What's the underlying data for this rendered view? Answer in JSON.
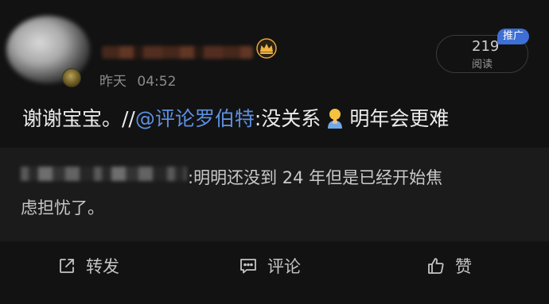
{
  "header": {
    "date_label": "昨天",
    "time": "04:52",
    "read_count": "219",
    "read_label": "阅读",
    "promo_tag": "推广",
    "avatar_icon": "blurred-avatar",
    "vip_icon": "crown-icon"
  },
  "post": {
    "text_prefix": "谢谢宝宝。//",
    "mention": "@评论罗伯特",
    "text_reply": ":没关系",
    "emoji": "person-emoji-icon",
    "text_suffix": "明年会更难",
    "mention_color": "#5d8fe0"
  },
  "quote": {
    "line1": ":明明还没到 24 年但是已经开始焦",
    "line2": "虑担忧了。"
  },
  "actions": {
    "repost": "转发",
    "comment": "评论",
    "like": "赞"
  }
}
